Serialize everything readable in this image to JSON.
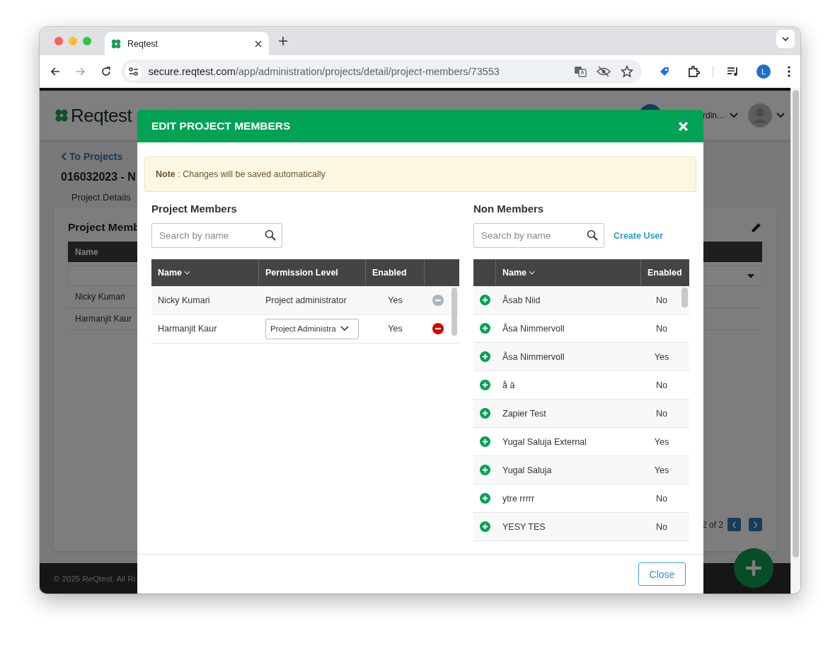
{
  "browser": {
    "tab_title": "Reqtest",
    "url_host": "secure.reqtest.com",
    "url_path": "/app/administration/projects/detail/project-members/73553",
    "profile_initial": "L"
  },
  "app": {
    "logo": "Reqtest",
    "user_name": "rdin…",
    "back_link": "To Projects",
    "project_title": "016032023 - N",
    "tabs": [
      {
        "label": "Project Details"
      }
    ],
    "card_title": "Project Memb",
    "table": {
      "columns": [
        "Name"
      ],
      "rows": [
        "Nicky Kumari",
        "Harmanjit Kaur"
      ]
    },
    "pagination": "2 of 2",
    "footer": "© 2025 ReQtest. All Ri"
  },
  "modal": {
    "title": "EDIT PROJECT MEMBERS",
    "note": "**Note** : Changes will be saved automatically",
    "members": {
      "heading": "Project Members",
      "search_placeholder": "Search by name",
      "columns": [
        "Name",
        "Permission Level",
        "Enabled"
      ],
      "rows": [
        {
          "name": "Nicky Kumari",
          "kind": "text",
          "permission": "Project administrator",
          "enabled": "Yes",
          "remove_disabled": true
        },
        {
          "name": "Harmanjit Kaur",
          "kind": "select",
          "permission": "Project Administra",
          "enabled": "Yes",
          "remove_disabled": false
        }
      ]
    },
    "non_members": {
      "heading": "Non Members",
      "search_placeholder": "Search by name",
      "create_link": "Create User",
      "columns": [
        "Name",
        "Enabled"
      ],
      "rows": [
        {
          "name": "Åsab Niid",
          "enabled": "No"
        },
        {
          "name": "Åsa Nimmervoll",
          "enabled": "No"
        },
        {
          "name": "Åsa Nimmervoll",
          "enabled": "Yes"
        },
        {
          "name": "å ä",
          "enabled": "No"
        },
        {
          "name": "Zapier Test",
          "enabled": "No"
        },
        {
          "name": "Yugal Saluja External",
          "enabled": "Yes"
        },
        {
          "name": "Yugal Saluja",
          "enabled": "Yes"
        },
        {
          "name": "ytre rrrrr",
          "enabled": "No"
        },
        {
          "name": "YESY TES",
          "enabled": "No"
        }
      ]
    },
    "close_button": "Close"
  }
}
